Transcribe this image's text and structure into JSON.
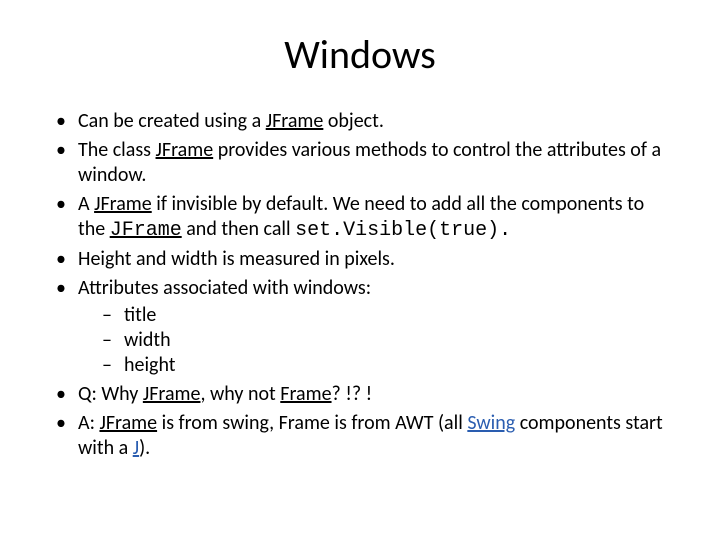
{
  "title": "Windows",
  "b1_a": "Can be created using a ",
  "b1_jframe": "JFrame",
  "b1_b": " object.",
  "b2_a": "The class ",
  "b2_jframe": "JFrame",
  "b2_b": " provides various methods to control the attributes of a window.",
  "b3_a": "A ",
  "b3_jframe": "JFrame",
  "b3_b": " if invisible by default. We need to add all the components to the ",
  "b3_jframe2": "JFrame",
  "b3_c": " and then call ",
  "b3_call": "set.Visible(true).",
  "b4": "Height and width is measured in pixels.",
  "b5": "Attributes associated with windows:",
  "s1": "title",
  "s2": "width",
  "s3": "height",
  "b6_a": "Q: Why ",
  "b6_jframe": "JFrame",
  "b6_b": ", why not ",
  "b6_frame": "Frame",
  "b6_c": "? !? !",
  "b7_a": "A: ",
  "b7_jframe": "JFrame",
  "b7_b": " is from swing, Frame is from AWT (all ",
  "b7_swing": "Swing",
  "b7_c": " components start with a ",
  "b7_j": "J",
  "b7_d": ")."
}
